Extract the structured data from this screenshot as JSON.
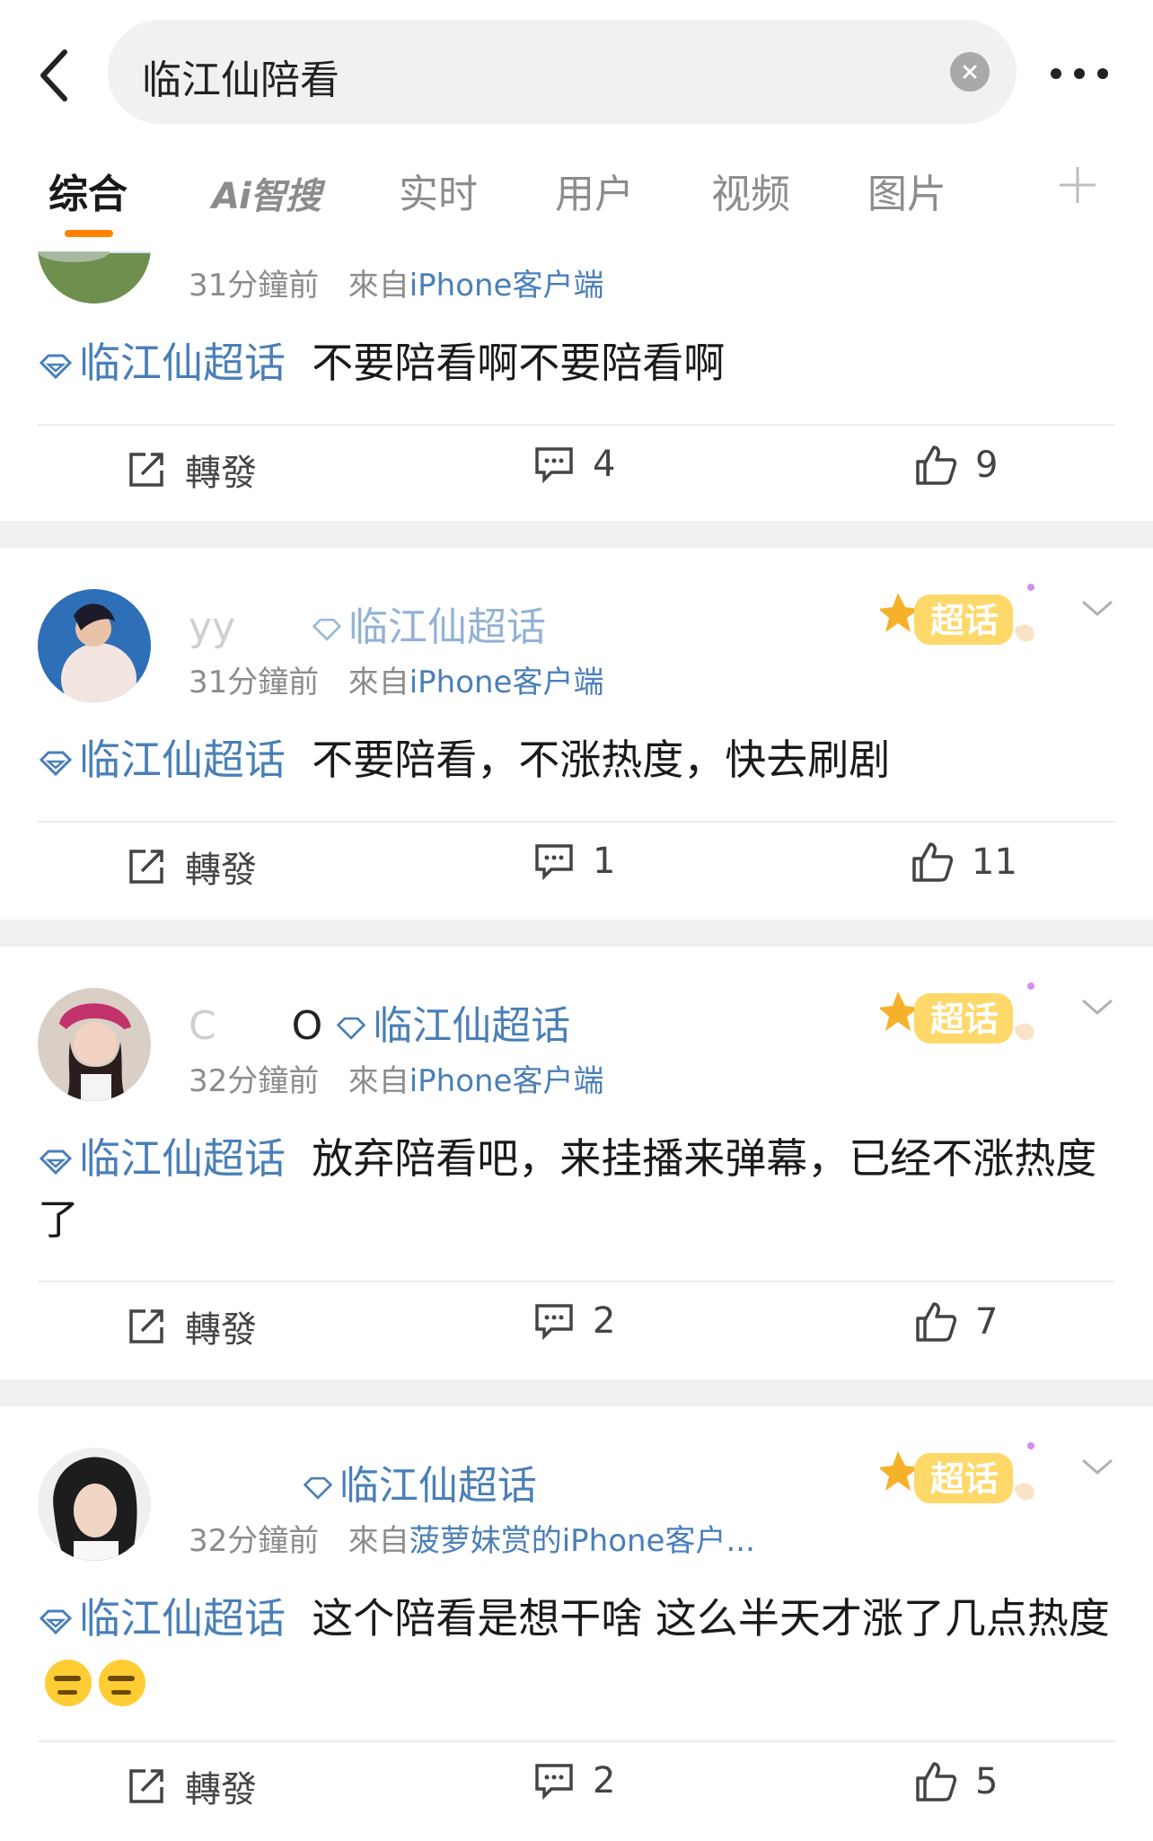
{
  "search": {
    "query": "临江仙陪看"
  },
  "tabs": [
    {
      "label": "综合"
    },
    {
      "label": "Ai智搜"
    },
    {
      "label": "实时"
    },
    {
      "label": "用户"
    },
    {
      "label": "视频"
    },
    {
      "label": "图片"
    }
  ],
  "posts": [
    {
      "user": "",
      "topic": "",
      "time": "31分鐘前",
      "from_label": "來自",
      "source": "iPhone客户端",
      "tag": "临江仙超话",
      "text": "不要陪看啊不要陪看啊",
      "repost_label": "轉發",
      "comments": "4",
      "likes": "9"
    },
    {
      "user": "yy",
      "topic": "临江仙超话",
      "time": "31分鐘前",
      "from_label": "來自",
      "source": "iPhone客户端",
      "tag": "临江仙超话",
      "text": "不要陪看，不涨热度，快去刷剧",
      "repost_label": "轉發",
      "comments": "1",
      "likes": "11",
      "badge": "超话"
    },
    {
      "user": "C",
      "topic": "临江仙超话",
      "time": "32分鐘前",
      "from_label": "來自",
      "source": "iPhone客户端",
      "tag": "临江仙超话",
      "text": "放弃陪看吧，来挂播来弹幕，已经不涨热度了",
      "repost_label": "轉發",
      "comments": "2",
      "likes": "7",
      "badge": "超话"
    },
    {
      "user": "",
      "topic": "临江仙超话",
      "time": "32分鐘前",
      "from_label": "來自",
      "source": "菠萝妹赏的iPhone客户...",
      "tag": "临江仙超话",
      "text": "这个陪看是想干啥 这么半天才涨了几点热度",
      "repost_label": "轉發",
      "comments": "2",
      "likes": "5",
      "badge": "超话"
    }
  ],
  "colors": {
    "accent": "#ff8200",
    "link": "#4a7fb8",
    "badge": "#f6a623"
  }
}
